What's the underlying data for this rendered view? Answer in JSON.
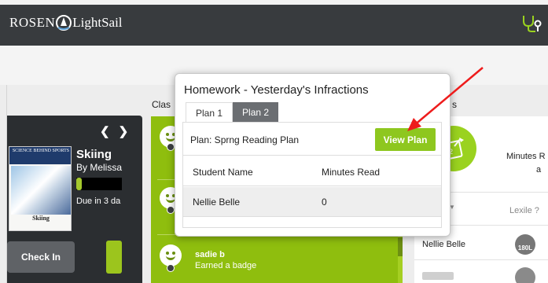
{
  "app": {
    "logo_word1": "ROSEN",
    "logo_word2": "LightSail",
    "accent_color": "#8ec71f"
  },
  "icons": [
    "rosen-lightsail-logo-icon",
    "stethoscope-icon",
    "chevron-left-icon",
    "chevron-right-icon",
    "smiley-icon",
    "goal-clipboard-icon",
    "lexile-badge-icon"
  ],
  "book": {
    "cover_series": "SCIENCE BEHIND SPORTS",
    "cover_title": "Skiing",
    "title": "Skiing",
    "author": "By Melissa",
    "progress": 0.12,
    "due": "Due in 3 da",
    "checkin_label": "Check In"
  },
  "class_feed": {
    "label": "Clas",
    "student": "sadie b",
    "event": "Earned a badge"
  },
  "goals": {
    "label": "s",
    "minutes_label": "Minutes R",
    "minutes_label2": "a",
    "lexile_header": "Lexile ?",
    "student": "Nellie Belle",
    "lexile_value": "180L"
  },
  "modal": {
    "title": "Homework - Yesterday's Infractions",
    "tabs": [
      "Plan 1",
      "Plan 2"
    ],
    "plan_label": "Plan: Sprng Reading Plan",
    "view_plan_label": "View Plan",
    "columns": [
      "Student Name",
      "Minutes Read"
    ],
    "rows": [
      {
        "name": "Nellie Belle",
        "minutes": "0"
      }
    ]
  }
}
